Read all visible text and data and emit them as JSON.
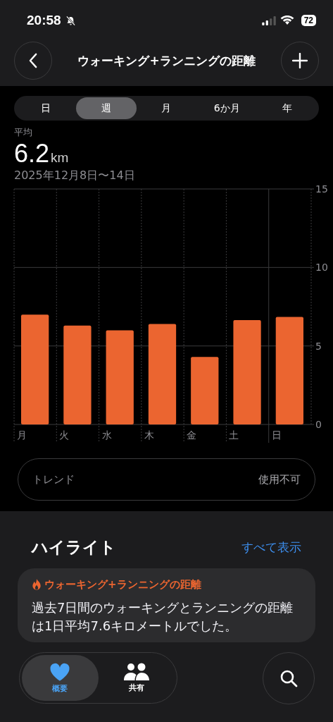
{
  "status_bar": {
    "time": "20:58",
    "battery": "72"
  },
  "nav": {
    "title": "ウォーキング+ランニングの距離"
  },
  "segments": [
    {
      "label": "日",
      "selected": false
    },
    {
      "label": "週",
      "selected": true
    },
    {
      "label": "月",
      "selected": false
    },
    {
      "label": "6か月",
      "selected": false
    },
    {
      "label": "年",
      "selected": false
    }
  ],
  "summary": {
    "label": "平均",
    "value": "6.2",
    "unit": "km",
    "date_range": "2025年12月8日〜14日"
  },
  "chart_data": {
    "type": "bar",
    "categories": [
      "月",
      "火",
      "水",
      "木",
      "金",
      "土",
      "日"
    ],
    "series": [
      {
        "color": "#eb6530",
        "values": [
          7.0,
          6.3,
          6.0,
          6.4,
          4.3,
          6.65,
          6.85
        ]
      }
    ],
    "ylim": [
      0,
      15
    ],
    "yticks": [
      0,
      5,
      10,
      15
    ]
  },
  "trend": {
    "label": "トレンド",
    "value": "使用不可"
  },
  "highlights": {
    "title": "ハイライト",
    "link": "すべて表示",
    "card": {
      "title": "ウォーキング+ランニングの距離",
      "body": "過去7日間のウォーキングとランニングの距離は1日平均7.6キロメートルでした。"
    }
  },
  "tab_bar": [
    {
      "label": "概要",
      "selected": true
    },
    {
      "label": "共有",
      "selected": false
    }
  ]
}
